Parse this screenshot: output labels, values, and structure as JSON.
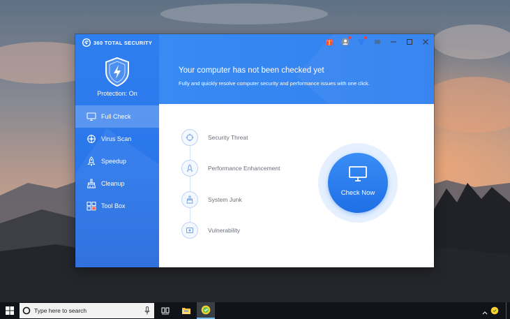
{
  "app": {
    "brand_name": "360 TOTAL SECURITY",
    "protection_status": "Protection: On",
    "header": {
      "title": "Your computer has not been checked yet",
      "subtitle": "Fully and quickly resolve computer security and performance issues with one click."
    },
    "titlebar_icons": [
      "gift-icon",
      "user-icon",
      "skin-icon",
      "menu-icon",
      "minimize-icon",
      "maximize-icon",
      "close-icon"
    ],
    "sidebar": {
      "items": [
        {
          "label": "Full Check",
          "icon": "monitor-icon",
          "active": true
        },
        {
          "label": "Virus Scan",
          "icon": "virus-scan-icon",
          "active": false
        },
        {
          "label": "Speedup",
          "icon": "rocket-icon",
          "active": false
        },
        {
          "label": "Cleanup",
          "icon": "broom-icon",
          "active": false
        },
        {
          "label": "Tool Box",
          "icon": "toolbox-icon",
          "active": false
        }
      ]
    },
    "checks": [
      {
        "label": "Security Threat",
        "icon": "target-icon"
      },
      {
        "label": "Performance Enhancement",
        "icon": "rocket-icon"
      },
      {
        "label": "System Junk",
        "icon": "broom-icon"
      },
      {
        "label": "Vulnerability",
        "icon": "patch-icon"
      }
    ],
    "check_button": {
      "label": "Check Now",
      "icon": "monitor-icon"
    }
  },
  "taskbar": {
    "search_placeholder": "Type here to search",
    "apps": [
      "task-view-icon",
      "file-explorer-icon",
      "360-security-icon"
    ]
  },
  "colors": {
    "primary": "#2f7ff0",
    "primary_dark": "#1f6fe6",
    "sidebar_active": "#5d9df3",
    "text_muted": "#6b6f78",
    "taskbar": "#101418"
  }
}
